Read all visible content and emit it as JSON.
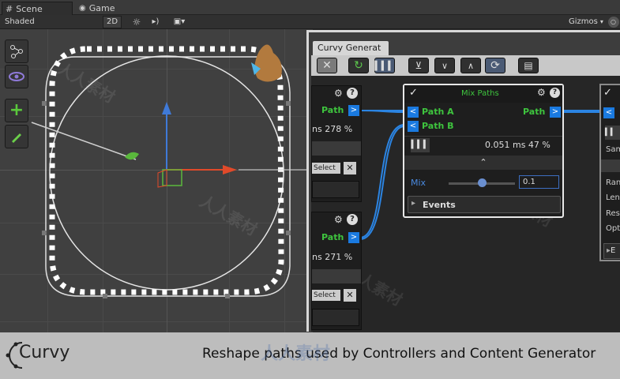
{
  "scene_tabs": {
    "scene": "Scene",
    "game": "Game"
  },
  "scene_toolbar": {
    "shading": "Shaded",
    "mode_2d": "2D",
    "gizmos": "Gizmos"
  },
  "tool_palette": [
    "spline-tool-icon",
    "eye-icon",
    "plus-icon",
    "pencil-icon"
  ],
  "window": {
    "title": "Curvy Generat"
  },
  "toolbar_icons": [
    "close-icon",
    "refresh-icon",
    "stats-icon",
    "collapse-all-icon",
    "chevron-down-icon",
    "chevron-up-icon",
    "reload-icon",
    "save-icon"
  ],
  "left_node_top": {
    "path_label": "Path",
    "perf": "ns  278 %",
    "select": "Select"
  },
  "left_node_bottom": {
    "path_label": "Path",
    "perf": "ns  271 %",
    "select": "Select"
  },
  "mix_node": {
    "title": "Mix Paths",
    "input_a": "Path A",
    "input_b": "Path B",
    "output": "Path",
    "perf": "0.051 ms  47 %",
    "mix_label": "Mix",
    "mix_value": "0.1",
    "mix_slider": 0.5,
    "events_label": "Events"
  },
  "right_node": {
    "port": "<",
    "rows": [
      "Sam",
      "Ran",
      "Len",
      "Res",
      "Opt"
    ],
    "footer": "E"
  },
  "footer": {
    "logo": "Curvy",
    "caption": "Reshape paths used by Controllers and Content Generator"
  },
  "watermarks": [
    "人人素材",
    "人人素材",
    "人人素材",
    "人人素材",
    "人人素材",
    "人人素材"
  ],
  "colors": {
    "accent_green": "#3ec43e",
    "port_blue": "#1a7ae0",
    "node_bg": "#1e1e1e",
    "footer_bg": "#bdbdbd"
  }
}
